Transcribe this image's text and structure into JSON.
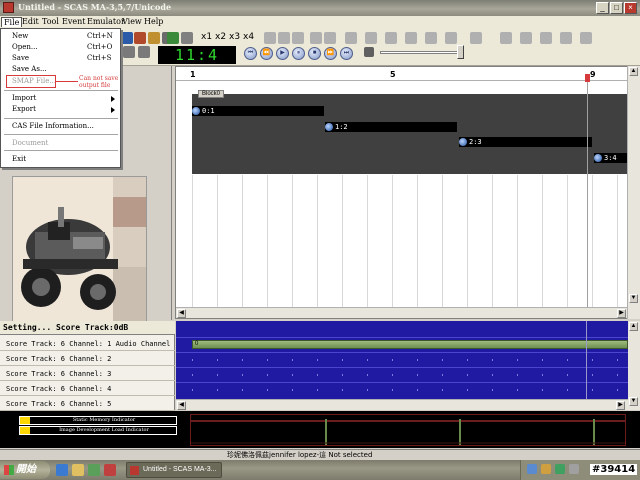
{
  "window": {
    "title": "Untitled - SCAS MA-3,5,7/Unicode",
    "minimize_label": "_",
    "maximize_label": "□",
    "close_label": "×"
  },
  "menubar": {
    "items": [
      "File",
      "Edit",
      "Tool",
      "Event",
      "Emulator",
      "View",
      "Help"
    ]
  },
  "file_menu": {
    "new": "New",
    "new_shortcut": "Ctrl+N",
    "open": "Open...",
    "open_shortcut": "Ctrl+O",
    "save": "Save",
    "save_shortcut": "Ctrl+S",
    "save_as": "Save As...",
    "smap": "SMAP File...",
    "import": "Import",
    "export": "Export",
    "cas_info": "CAS File Information...",
    "document": "Document",
    "exit": "Exit"
  },
  "annotation": {
    "warning": "Can not save output file"
  },
  "toolbar": {
    "zoom_labels": [
      "x1",
      "x2",
      "x3",
      "x4"
    ],
    "bar_display": "11:4"
  },
  "timeline": {
    "ruler_marks": [
      "1",
      "5",
      "9"
    ],
    "block_label": "Block0",
    "clips": [
      "0:1",
      "1:2",
      "2:3",
      "3:4"
    ]
  },
  "score_panel": {
    "header": "Setting... Score Track:0dB",
    "rows": [
      "Score  Track: 6  Channel:  1  Audio Channel",
      "Score  Track: 6  Channel:  2",
      "Score  Track: 6  Channel:  3",
      "Score  Track: 6  Channel:  4",
      "Score  Track: 6  Channel:  5"
    ],
    "audio_bar_label": "0"
  },
  "indicators": {
    "memory": "Static Memory Indicator",
    "image_load": "Image Development Load Indicator"
  },
  "status": {
    "text": "珍妮佛洛佩茲jennifer lopez-這  Not selected"
  },
  "taskbar": {
    "start_label": "開始",
    "task_item": "Untitled - SCAS MA-3...",
    "watermark": "#39414"
  }
}
